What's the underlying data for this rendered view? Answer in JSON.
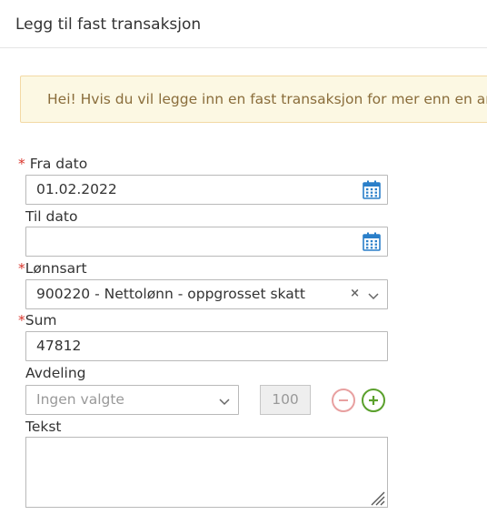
{
  "modal": {
    "title": "Legg til fast transaksjon"
  },
  "alert": {
    "text": "Hei! Hvis du vil legge inn en fast transaksjon for mer enn en ansatt"
  },
  "form": {
    "required_mark": "*",
    "fra_dato": {
      "label": "Fra dato",
      "value": "01.02.2022",
      "icon": "calendar-icon"
    },
    "til_dato": {
      "label": "Til dato",
      "value": "",
      "icon": "calendar-icon"
    },
    "lonnsart": {
      "label": "Lønnsart",
      "value": "900220 - Nettolønn - oppgrosset skatt",
      "clear": "×"
    },
    "sum": {
      "label": "Sum",
      "value": "47812"
    },
    "avdeling": {
      "label": "Avdeling",
      "placeholder": "Ingen valgte",
      "percent": "100"
    },
    "tekst": {
      "label": "Tekst",
      "value": ""
    }
  },
  "colors": {
    "alert_bg": "#fcf8e3",
    "alert_border": "#f3d9a5",
    "required": "#d9342b",
    "calendar": "#2a7fc9",
    "remove": "#e8a0a0",
    "add": "#5aa02c"
  }
}
